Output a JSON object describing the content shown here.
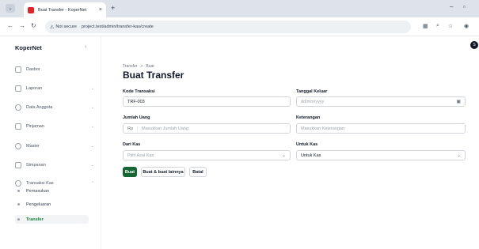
{
  "browser": {
    "tab_title": "Buat Transfer - KoperNet",
    "tab_close": "×",
    "new_tab": "+",
    "not_secure": "Not secure",
    "url": "project.test/admin/transfer-kas/create"
  },
  "app": {
    "brand": "KoperNet",
    "avatar_initial": "S"
  },
  "sidebar": {
    "items": [
      {
        "label": "Dasbor"
      },
      {
        "label": "Laporan"
      },
      {
        "label": "Data Anggota"
      },
      {
        "label": "Pinjaman"
      },
      {
        "label": "Master"
      },
      {
        "label": "Simpanan"
      },
      {
        "label": "Transaksi Kas"
      }
    ],
    "subitems": [
      {
        "label": "Pemasukan"
      },
      {
        "label": "Pengeluaran"
      },
      {
        "label": "Transfer"
      }
    ]
  },
  "page": {
    "breadcrumb": [
      "Transfer",
      "Buat"
    ],
    "breadcrumb_sep": ">",
    "title": "Buat Transfer"
  },
  "form": {
    "kode_label": "Kode Transaksi",
    "kode_value": "TRF-003",
    "tanggal_label": "Tanggal Keluar",
    "tanggal_placeholder": "dd/mm/yyyy",
    "jumlah_label": "Jumlah Uang",
    "jumlah_prefix": "Rp",
    "jumlah_placeholder": "Masukkan Jumlah Uang",
    "keterangan_label": "Keterangan",
    "keterangan_placeholder": "Masukkan Keterangan",
    "dari_label": "Dari Kas",
    "dari_value": "Pilih Asal Kas",
    "untuk_label": "Untuk Kas",
    "untuk_value": "Untuk Kas"
  },
  "actions": {
    "create": "Buat",
    "create_another": "Buat & buat lainnya",
    "cancel": "Batal"
  }
}
